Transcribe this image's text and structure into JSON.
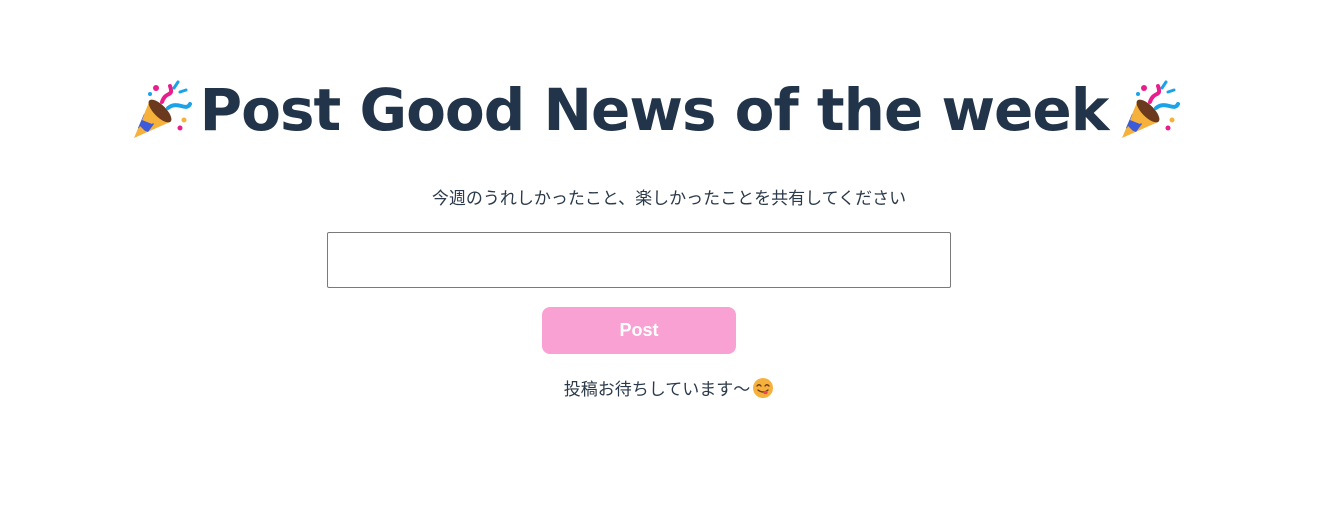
{
  "header": {
    "title": "Post Good News of the week",
    "left_icon": "party-popper-icon",
    "right_icon": "party-popper-icon"
  },
  "form": {
    "prompt": "今週のうれしかったこと、楽しかったことを共有してください",
    "input_value": "",
    "post_label": "Post"
  },
  "footer": {
    "message": "投稿お待ちしています〜",
    "icon": "yum-face-icon"
  },
  "colors": {
    "title": "#223449",
    "button_bg": "#f9a1d2",
    "button_text": "#ffffff",
    "input_border": "#7a7a7a"
  }
}
